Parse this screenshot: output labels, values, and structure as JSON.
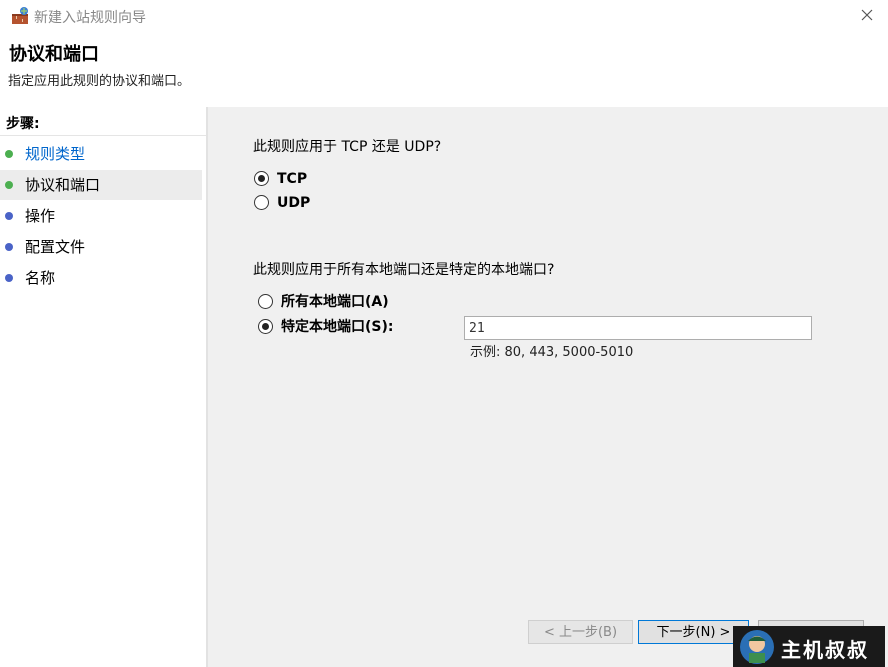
{
  "window": {
    "title": "新建入站规则向导",
    "close_icon": "close-icon"
  },
  "header": {
    "title": "协议和端口",
    "subtitle": "指定应用此规则的协议和端口。"
  },
  "sidebar": {
    "label": "步骤:",
    "items": [
      {
        "label": "规则类型",
        "dot_color": "#4caf50",
        "state": "done"
      },
      {
        "label": "协议和端口",
        "dot_color": "#4caf50",
        "state": "current"
      },
      {
        "label": "操作",
        "dot_color": "#4a63c7",
        "state": "pending"
      },
      {
        "label": "配置文件",
        "dot_color": "#4a63c7",
        "state": "pending"
      },
      {
        "label": "名称",
        "dot_color": "#4a63c7",
        "state": "pending"
      }
    ]
  },
  "main": {
    "question_protocol": "此规则应用于 TCP 还是 UDP?",
    "tcp_label": "TCP",
    "udp_label": "UDP",
    "question_ports": "此规则应用于所有本地端口还是特定的本地端口?",
    "all_ports_label": "所有本地端口(A)",
    "specific_ports_label": "特定本地端口(S):",
    "ports_value": "21",
    "example": "示例: 80, 443, 5000-5010",
    "selected_protocol": "TCP",
    "selected_port_scope": "specific"
  },
  "buttons": {
    "back": "< 上一步(B)",
    "next": "下一步(N) >"
  },
  "watermark": {
    "text": "主机叔叔"
  },
  "colors": {
    "link_blue": "#0066cc",
    "accent": "#0078d7"
  }
}
